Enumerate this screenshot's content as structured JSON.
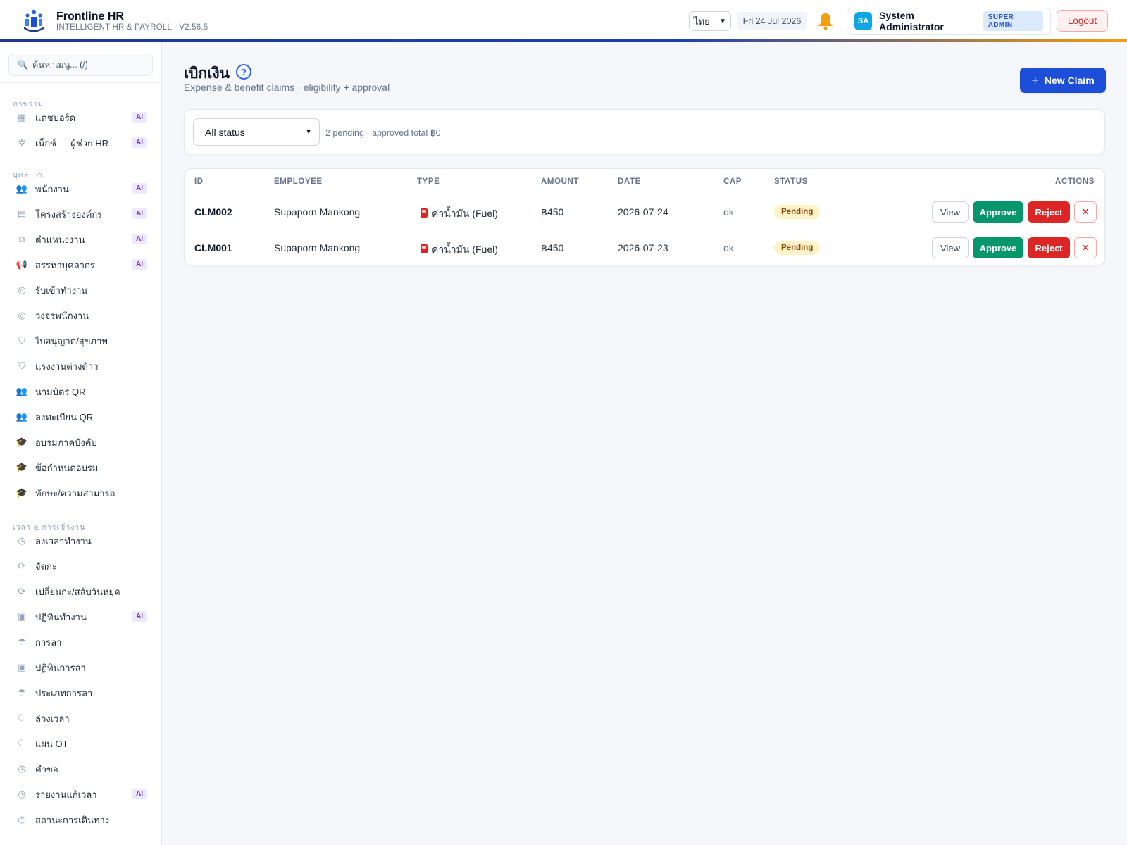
{
  "header": {
    "brand_name": "Frontline HR",
    "brand_sub": "INTELLIGENT HR & PAYROLL · V2.56.5",
    "language": "ไทย",
    "date": "Fri 24 Jul 2026",
    "user_initials": "SA",
    "user_name": "System Administrator",
    "role": "SUPER ADMIN",
    "logout_label": "Logout"
  },
  "sidebar": {
    "search_placeholder": "ค้นหาเมนู... (/)",
    "sections": [
      {
        "title": "ภาพรวม"
      },
      {
        "title": "บุคลากร"
      },
      {
        "title": "เวลา & การเข้างาน"
      }
    ],
    "items": [
      {
        "label": "แดชบอร์ด",
        "icon": "grid-icon",
        "ai": "AI"
      },
      {
        "label": "เน็กซ์ — ผู้ช่วย HR",
        "icon": "sparkle-icon",
        "ai": "AI"
      },
      {
        "label": "พนักงาน",
        "icon": "users-icon",
        "ai": "AI"
      },
      {
        "label": "โครงสร้างองค์กร",
        "icon": "building-icon",
        "ai": "AI"
      },
      {
        "label": "ตำแหน่งงาน",
        "icon": "org-chart-icon",
        "ai": "AI"
      },
      {
        "label": "สรรหาบุคลากร",
        "icon": "megaphone-icon",
        "ai": "AI"
      },
      {
        "label": "รับเข้าทำงาน",
        "icon": "compass-icon"
      },
      {
        "label": "วงจรพนักงาน",
        "icon": "compass-icon"
      },
      {
        "label": "ใบอนุญาต/สุขภาพ",
        "icon": "shield-icon"
      },
      {
        "label": "แรงงานต่างด้าว",
        "icon": "shield-icon"
      },
      {
        "label": "นามบัตร QR",
        "icon": "users-icon"
      },
      {
        "label": "ลงทะเบียน QR",
        "icon": "users-icon"
      },
      {
        "label": "อบรมภาคบังคับ",
        "icon": "graduation-cap-icon"
      },
      {
        "label": "ข้อกำหนดอบรม",
        "icon": "graduation-cap-icon"
      },
      {
        "label": "ทักษะ/ความสามารถ",
        "icon": "graduation-cap-icon"
      },
      {
        "label": "ลงเวลาทำงาน",
        "icon": "clock-icon"
      },
      {
        "label": "จัดกะ",
        "icon": "refresh-icon"
      },
      {
        "label": "เปลี่ยนกะ/สลับวันหยุด",
        "icon": "refresh-icon"
      },
      {
        "label": "ปฏิทินทำงาน",
        "icon": "calendar-icon",
        "ai": "AI"
      },
      {
        "label": "การลา",
        "icon": "umbrella-icon"
      },
      {
        "label": "ปฏิทินการลา",
        "icon": "calendar-icon"
      },
      {
        "label": "ประเภทการลา",
        "icon": "umbrella-icon"
      },
      {
        "label": "ล่วงเวลา",
        "icon": "moon-icon"
      },
      {
        "label": "แผน OT",
        "icon": "moon-icon"
      },
      {
        "label": "คำขอ",
        "icon": "clock-icon"
      },
      {
        "label": "รายงานแก้เวลา",
        "icon": "clock-icon",
        "ai": "AI"
      },
      {
        "label": "สถานะการเดินทาง",
        "icon": "clock-icon"
      }
    ]
  },
  "main": {
    "title": "เบิกเงิน",
    "help": "?",
    "subtitle": "Expense & benefit claims · eligibility + approval",
    "new_claim_label": "New Claim",
    "filter": {
      "selected": "All status",
      "summary": "2 pending · approved total ฿0"
    },
    "table": {
      "columns": [
        "ID",
        "EMPLOYEE",
        "TYPE",
        "AMOUNT",
        "DATE",
        "CAP",
        "STATUS",
        "ACTIONS"
      ],
      "rows": [
        {
          "id": "CLM002",
          "employee": "Supaporn Mankong",
          "type": "ค่าน้ำมัน (Fuel)",
          "amount": "฿450",
          "date": "2026-07-24",
          "cap": "ok",
          "status": "Pending"
        },
        {
          "id": "CLM001",
          "employee": "Supaporn Mankong",
          "type": "ค่าน้ำมัน (Fuel)",
          "amount": "฿450",
          "date": "2026-07-23",
          "cap": "ok",
          "status": "Pending"
        }
      ],
      "actions": {
        "view": "View",
        "approve": "Approve",
        "reject": "Reject",
        "delete": "✕"
      }
    }
  },
  "colors": {
    "primary": "#1d4ed8",
    "approve": "#059669",
    "reject": "#dc2626",
    "pending_bg": "#fef3c7",
    "ai_badge": "#6d28d9"
  }
}
